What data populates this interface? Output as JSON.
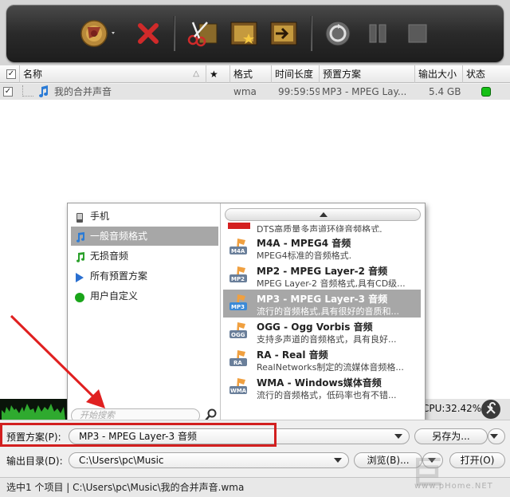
{
  "toolbar": {
    "buttons": [
      {
        "name": "add-media-icon"
      },
      {
        "name": "delete-icon"
      },
      {
        "name": "cut-icon"
      },
      {
        "name": "effects-icon"
      },
      {
        "name": "merge-icon"
      },
      {
        "name": "convert-icon"
      },
      {
        "name": "pause-icon"
      },
      {
        "name": "stop-icon"
      }
    ]
  },
  "list": {
    "headers": {
      "name": "名称",
      "star": "★",
      "format": "格式",
      "duration": "时间长度",
      "preset": "预置方案",
      "output_size": "输出大小",
      "status": "状态"
    },
    "rows": [
      {
        "name": "我的合并声音",
        "format": "wma",
        "duration": "99:59:59",
        "preset": "MP3 - MPEG Lay...",
        "size": "5.4 GB"
      }
    ]
  },
  "popup": {
    "categories": [
      {
        "label": "手机",
        "icon": "phone-icon"
      },
      {
        "label": "一般音频格式",
        "icon": "music-note-icon"
      },
      {
        "label": "无损音频",
        "icon": "music-note-green-icon"
      },
      {
        "label": "所有预置方案",
        "icon": "play-triangle-icon"
      },
      {
        "label": "用户自定义",
        "icon": "green-circle-icon"
      }
    ],
    "search_placeholder": "开始搜索",
    "formats": [
      {
        "name": "",
        "desc": "DTS高质量多声道环绕音频格式.",
        "badge": ""
      },
      {
        "name": "M4A - MPEG4 音频",
        "desc": "MPEG4标准的音频格式.",
        "badge": "M4A"
      },
      {
        "name": "MP2 - MPEG Layer-2 音频",
        "desc": "MPEG Layer-2 音频格式,具有CD级...",
        "badge": "MP2"
      },
      {
        "name": "MP3 - MPEG Layer-3 音频",
        "desc": "流行的音频格式,具有很好的音质和...",
        "badge": "MP3"
      },
      {
        "name": "OGG - Ogg Vorbis 音频",
        "desc": "支持多声道的音频格式，具有良好...",
        "badge": "OGG"
      },
      {
        "name": "RA - Real 音频",
        "desc": "RealNetworks制定的流媒体音频格...",
        "badge": "RA"
      },
      {
        "name": "WMA - Windows媒体音频",
        "desc": "流行的音频格式，低码率也有不错...",
        "badge": "WMA"
      }
    ]
  },
  "status_strip": {
    "cpu": "CPU:32.42%"
  },
  "form": {
    "preset_label": "预置方案(P):",
    "preset_value": "MP3 - MPEG Layer-3 音频",
    "save_as": "另存为...",
    "output_label": "输出目录(D):",
    "output_value": "C:\\Users\\pc\\Music",
    "browse": "浏览(B)...",
    "open": "打开(O)"
  },
  "statusbar": {
    "text": "选中1 个项目 | C:\\Users\\pc\\Music\\我的合并声音.wma"
  },
  "watermark": {
    "text": "巨",
    "sub": "www.pHome.NET"
  },
  "colors": {
    "selection": "#a7a7a7",
    "highlight_box": "#d21f1f",
    "arrow": "#e02020",
    "status_green": "#16c016"
  }
}
